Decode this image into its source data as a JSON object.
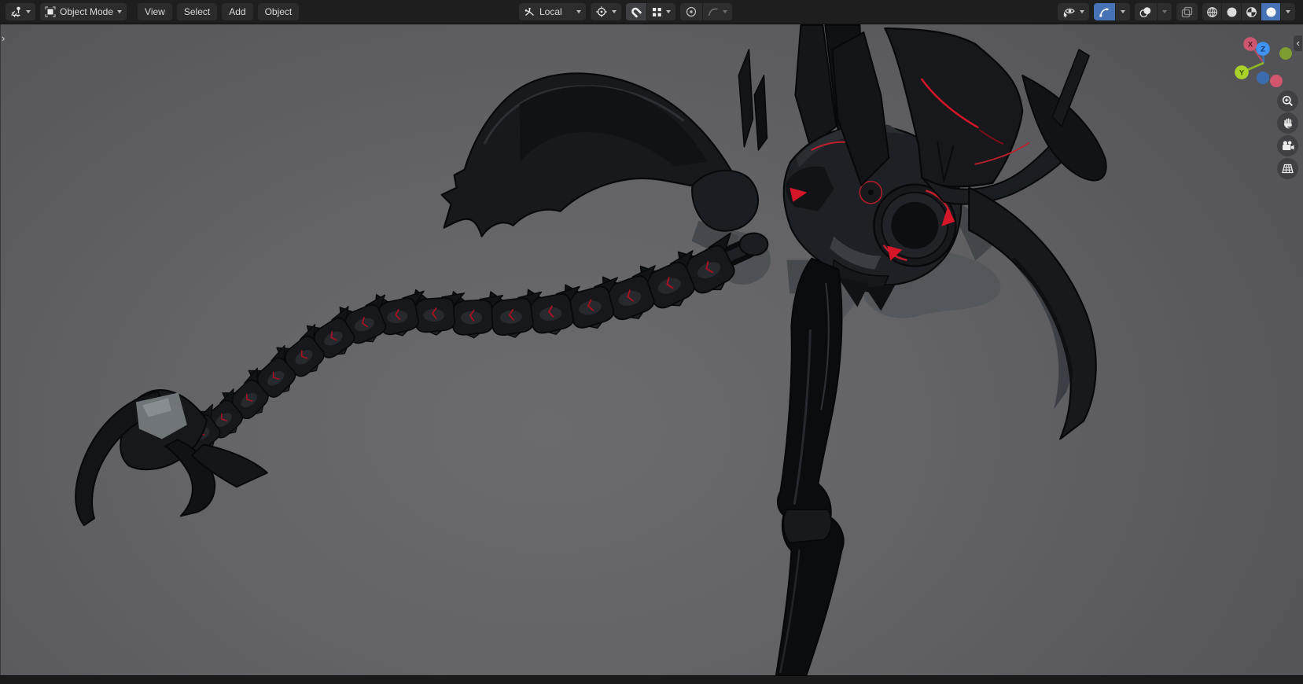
{
  "header": {
    "editor_type": {
      "icon": "editor-3d-viewport-icon"
    },
    "mode": {
      "label": "Object Mode",
      "icon": "object-mode-icon"
    },
    "menus": [
      "View",
      "Select",
      "Add",
      "Object"
    ],
    "transform_orientation": {
      "label": "Local",
      "icon": "orientation-axes-icon"
    },
    "pivot": {
      "icon": "pivot-point-icon"
    },
    "snap": {
      "magnet_icon": "snap-magnet-icon",
      "target_icon": "snap-increment-icon",
      "magnet_highlighted": true
    },
    "proportional": {
      "icon": "proportional-editing-icon",
      "falloff_icon": "falloff-curve-icon",
      "falloff_enabled": false
    },
    "visibility": {
      "icon": "show-object-types-icon"
    },
    "gizmos": {
      "icon": "viewport-gizmos-icon",
      "active": true
    },
    "overlays": {
      "icon": "overlays-icon",
      "active": false
    },
    "xray": {
      "icon": "toggle-xray-icon",
      "enabled": false
    },
    "shading": {
      "modes": [
        "wireframe",
        "solid",
        "material-preview",
        "rendered"
      ],
      "active": "rendered",
      "active_color": "#4772b3"
    }
  },
  "viewport": {
    "axis_gizmo": {
      "labels": {
        "x": "X",
        "y": "Y",
        "z": "Z"
      },
      "colors": {
        "x": "#d2566e",
        "y": "#a9d32a",
        "z": "#3f93f2"
      }
    },
    "nav_tools": [
      "zoom",
      "pan",
      "camera-view",
      "toggle-orthographic"
    ],
    "toolbar_expand": "›",
    "sidebar_collapse": "‹",
    "model": {
      "name": "mechanical-scorpion-creature",
      "accent_color": "#c81f2d",
      "body_color": "#16181c"
    }
  },
  "colors": {
    "header_bg": "#1e1e1e",
    "widget_bg": "#2d2d2d",
    "active_blue": "#4772b3",
    "viewport_bg": "#616164",
    "text": "#d9d9d9"
  }
}
